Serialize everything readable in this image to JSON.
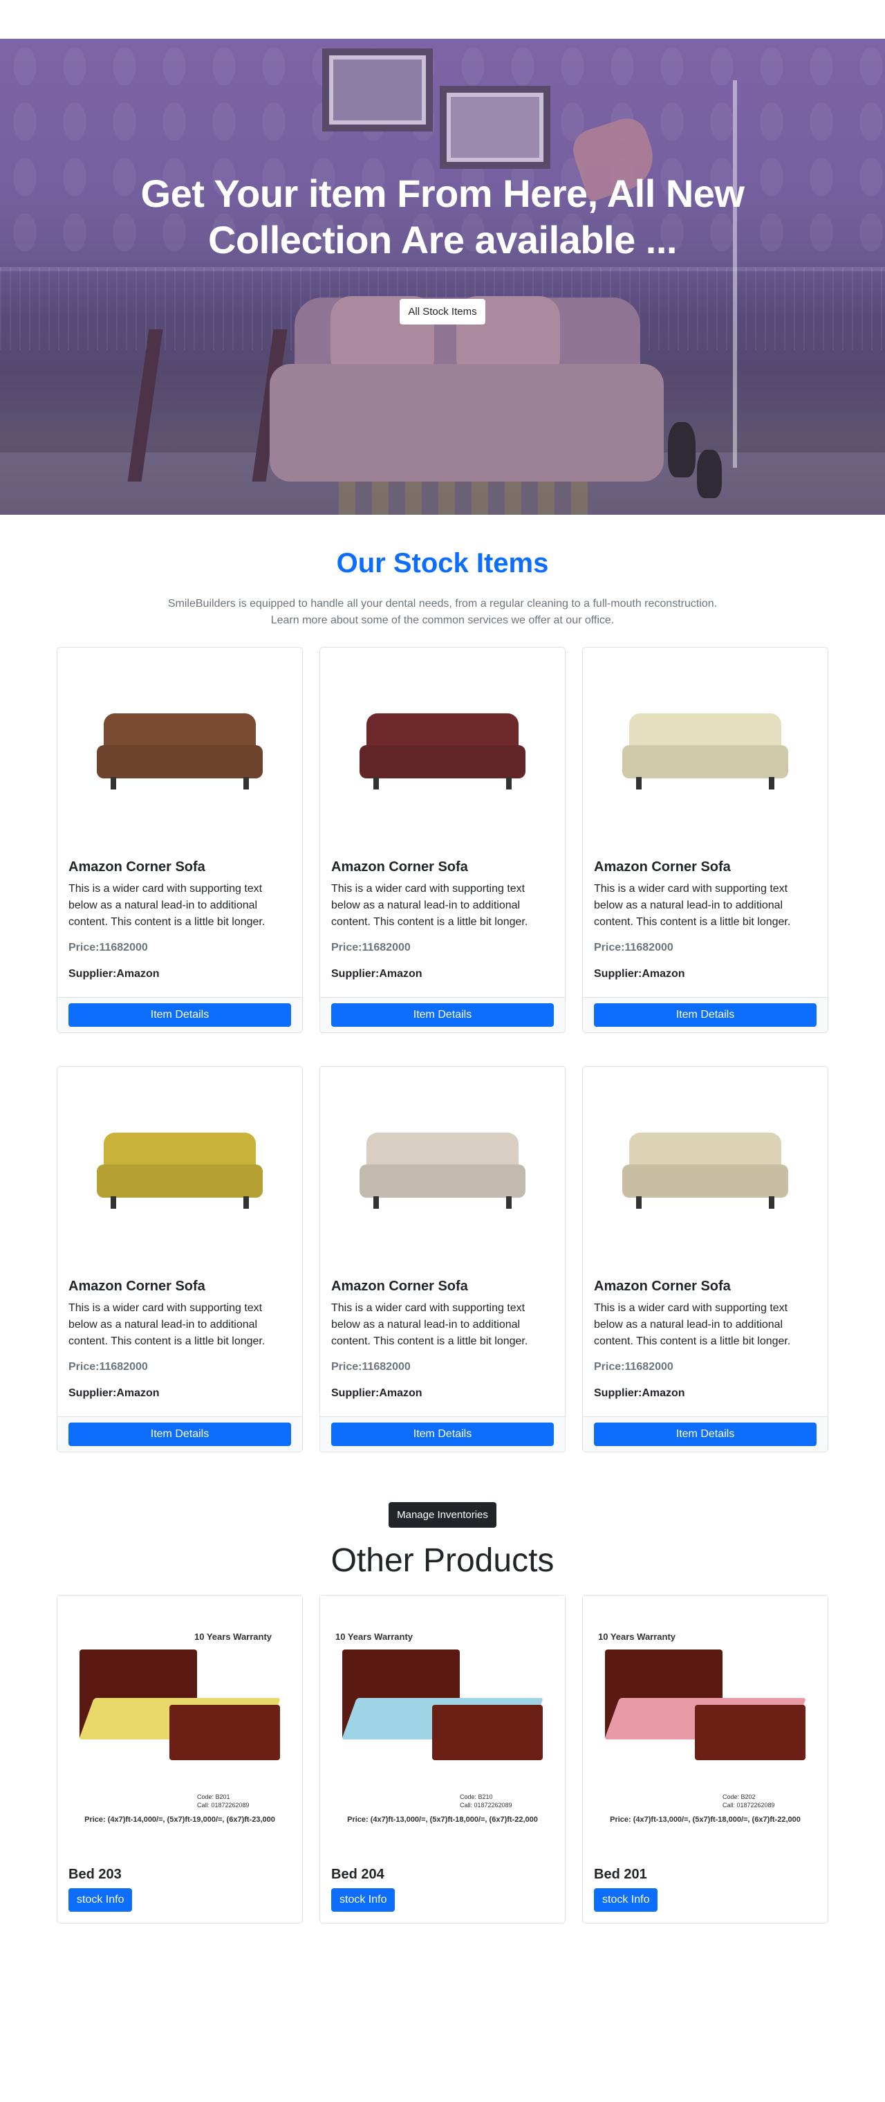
{
  "hero": {
    "title": "Get Your item From Here, All New Collection Are available ...",
    "button_label": "All Stock Items"
  },
  "stock": {
    "title": "Our Stock Items",
    "description_line1": "SmileBuilders is equipped to handle all your dental needs, from a regular cleaning to a full-mouth reconstruction.",
    "description_line2": "Learn more about some of the common services we offer at our office.",
    "items": [
      {
        "name": "Amazon Corner Sofa",
        "text": "This is a wider card with supporting text below as a natural lead-in to additional content. This content is a little bit longer.",
        "price": "Price:11682000",
        "supplier": "Supplier:Amazon",
        "button": "Item Details",
        "color": "#7a4a32"
      },
      {
        "name": "Amazon Corner Sofa",
        "text": "This is a wider card with supporting text below as a natural lead-in to additional content. This content is a little bit longer.",
        "price": "Price:11682000",
        "supplier": "Supplier:Amazon",
        "button": "Item Details",
        "color": "#6e2a2a"
      },
      {
        "name": "Amazon Corner Sofa",
        "text": "This is a wider card with supporting text below as a natural lead-in to additional content. This content is a little bit longer.",
        "price": "Price:11682000",
        "supplier": "Supplier:Amazon",
        "button": "Item Details",
        "color": "#e6dfbf"
      },
      {
        "name": "Amazon Corner Sofa",
        "text": "This is a wider card with supporting text below as a natural lead-in to additional content. This content is a little bit longer.",
        "price": "Price:11682000",
        "supplier": "Supplier:Amazon",
        "button": "Item Details",
        "color": "#c9b23a"
      },
      {
        "name": "Amazon Corner Sofa",
        "text": "This is a wider card with supporting text below as a natural lead-in to additional content. This content is a little bit longer.",
        "price": "Price:11682000",
        "supplier": "Supplier:Amazon",
        "button": "Item Details",
        "color": "#d8cfc2"
      },
      {
        "name": "Amazon Corner Sofa",
        "text": "This is a wider card with supporting text below as a natural lead-in to additional content. This content is a little bit longer.",
        "price": "Price:11682000",
        "supplier": "Supplier:Amazon",
        "button": "Item Details",
        "color": "#ddd3b6"
      }
    ]
  },
  "manage_button": "Manage Inventories",
  "other": {
    "title": "Other Products",
    "items": [
      {
        "name": "Bed 203",
        "button": "stock Info",
        "warranty": "10 Years Warranty",
        "codes": "Code: B201\nCall: 01872262089",
        "price_strip": "Price: (4x7)ft-14,000/=, (5x7)ft-19,000/=, (6x7)ft-23,000",
        "mattress": "#e9d96a"
      },
      {
        "name": "Bed 204",
        "button": "stock Info",
        "warranty": "10 Years Warranty",
        "codes": "Code: B210\nCall: 01872262089",
        "price_strip": "Price: (4x7)ft-13,000/=, (5x7)ft-18,000/=, (6x7)ft-22,000",
        "mattress": "#9fd3e6"
      },
      {
        "name": "Bed 201",
        "button": "stock Info",
        "warranty": "10 Years Warranty",
        "codes": "Code: B202\nCall: 01872262089",
        "price_strip": "Price: (4x7)ft-13,000/=, (5x7)ft-18,000/=, (6x7)ft-22,000",
        "mattress": "#e89aa6"
      }
    ]
  },
  "colors": {
    "primary": "#0d6efd",
    "dark": "#212529",
    "muted": "#6c757d"
  }
}
